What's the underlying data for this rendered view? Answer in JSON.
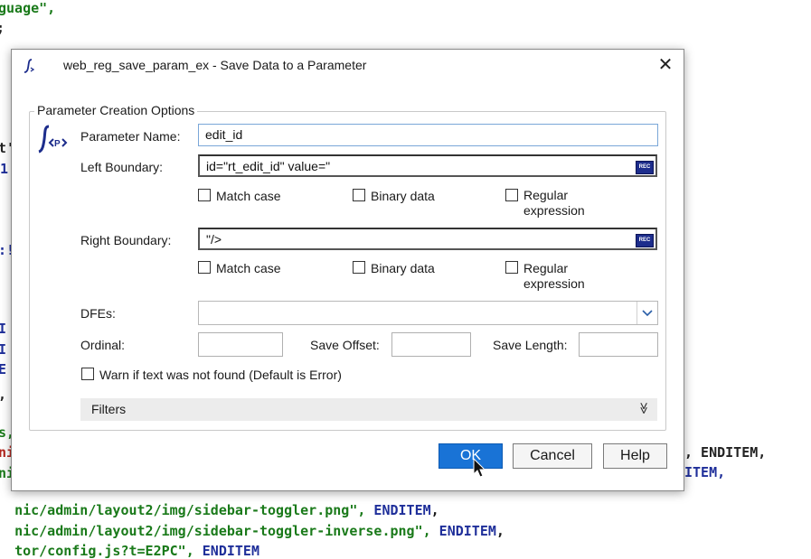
{
  "background_code": {
    "line1": "guage\",",
    "line2": "nic/admin/layout2/img/sidebar-toggler.png\", ",
    "line2_kw": "ENDITEM",
    "line3": "nic/admin/layout2/img/sidebar-toggler-inverse.png\", ",
    "line3_kw": "ENDITEM",
    "line4": "tor/config.js?t=E2PC\", ",
    "line4_kw": "ENDITEM",
    "right_frag1": ", ENDITEM,",
    "right_frag2": "ITEM,"
  },
  "dialog": {
    "title": "web_reg_save_param_ex - Save Data to a Parameter",
    "close_glyph": "✕",
    "group_title": "Parameter Creation Options",
    "param_name_label": "Parameter Name:",
    "param_name_value": "edit_id",
    "left_boundary_label": "Left Boundary:",
    "left_boundary_value": "id=\"rt_edit_id\" value=\"",
    "right_boundary_label": "Right Boundary:",
    "right_boundary_value": "\"/>",
    "rec_label": "REC",
    "match_case": "Match case",
    "binary_data": "Binary data",
    "regular": "Regular",
    "expression": "expression",
    "dfes_label": "DFEs:",
    "dfes_value": "",
    "ordinal_label": "Ordinal:",
    "save_offset_label": "Save Offset:",
    "save_length_label": "Save Length:",
    "warn_label": "Warn if text was not found (Default is Error)",
    "filters_label": "Filters",
    "filters_chevron": "≫",
    "ok_label": "OK",
    "cancel_label": "Cancel",
    "help_label": "Help"
  },
  "colors": {
    "code_string": "#1a7a1a",
    "code_keyword": "#1f2f9a",
    "ok_button": "#1973d6",
    "rec_button": "#1d2d8c"
  }
}
